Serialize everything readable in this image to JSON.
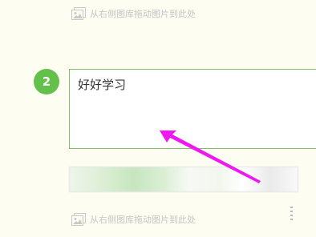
{
  "image_drop_hint": {
    "icon": "image-icon",
    "text": "从右侧图库拖动图片到此处"
  },
  "step": {
    "number": "2",
    "text": "好好学习"
  },
  "colors": {
    "background": "#fdfdf2",
    "step_badge": "#63c04a",
    "textarea_border": "#7ac35d",
    "arrow": "#f018f0",
    "hint_text": "#c4c4c4"
  }
}
